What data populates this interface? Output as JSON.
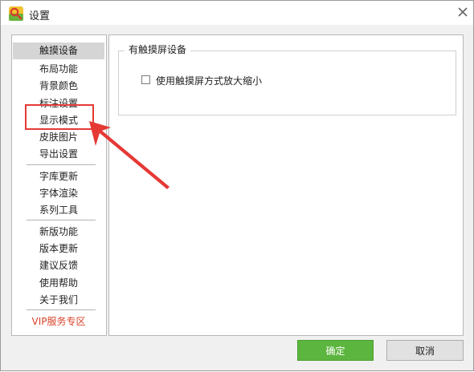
{
  "window": {
    "title": "设置",
    "icons": {
      "app": "app-logo-icon",
      "close": "close-icon"
    }
  },
  "sidebar": {
    "items": [
      {
        "label": "触摸设备",
        "selected": true
      },
      {
        "label": "布局功能"
      },
      {
        "label": "背景颜色"
      },
      {
        "label": "标注设置"
      },
      {
        "label": "显示模式",
        "highlighted": true
      },
      {
        "label": "皮肤图片"
      },
      {
        "label": "导出设置"
      },
      {
        "label": "字库更新"
      },
      {
        "label": "字体渲染"
      },
      {
        "label": "系列工具"
      },
      {
        "label": "新版功能"
      },
      {
        "label": "版本更新"
      },
      {
        "label": "建议反馈"
      },
      {
        "label": "使用帮助"
      },
      {
        "label": "关于我们"
      },
      {
        "label": "VIP服务专区",
        "accent": "#d9432b"
      }
    ]
  },
  "main": {
    "group_title": "有触摸屏设备",
    "options": [
      {
        "label": "使用触摸屏方式放大缩小",
        "checked": false
      }
    ]
  },
  "buttons": {
    "ok": "确定",
    "cancel": "取消"
  },
  "colors": {
    "ok_button": "#5cb53e",
    "annotation": "#e53935",
    "vip_text": "#d9432b"
  },
  "annotation": {
    "target": "显示模式",
    "icon": "arrow-annotation-icon"
  }
}
